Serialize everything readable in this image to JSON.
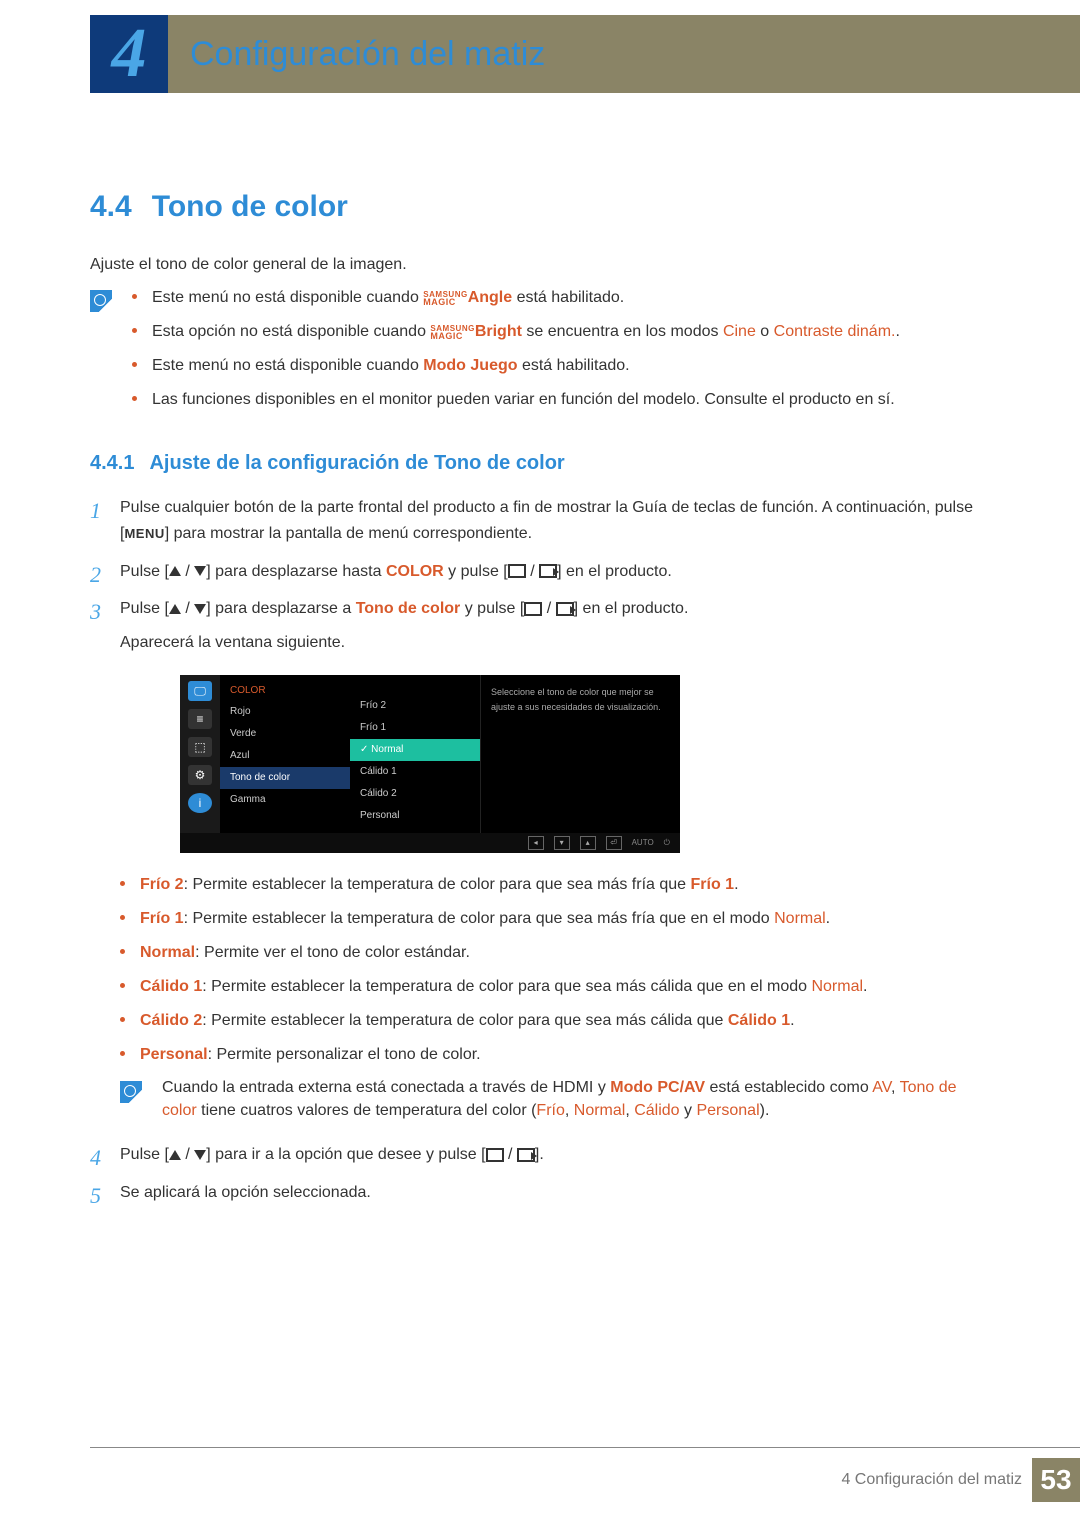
{
  "chapter": {
    "num": "4",
    "title": "Configuración del matiz"
  },
  "section": {
    "num": "4.4",
    "title": "Tono de color"
  },
  "intro": "Ajuste el tono de color general de la imagen.",
  "magic_brand": {
    "top": "SAMSUNG",
    "bottom": "MAGIC"
  },
  "notes1": {
    "b1_a": "Este menú no está disponible cuando ",
    "b1_b": "Angle",
    "b1_c": " está habilitado.",
    "b2_a": "Esta opción no está disponible cuando ",
    "b2_b": "Bright",
    "b2_c": " se encuentra en los modos ",
    "b2_cine": "Cine",
    "b2_d": " o ",
    "b2_contraste": "Contraste dinám.",
    "b3_a": "Este menú no está disponible cuando ",
    "b3_modo": "Modo Juego",
    "b3_b": " está habilitado.",
    "b4": "Las funciones disponibles en el monitor pueden variar en función del modelo. Consulte el producto en sí."
  },
  "subsection": {
    "num": "4.4.1",
    "title": "Ajuste de la configuración de Tono de color"
  },
  "steps": {
    "s1a": "Pulse cualquier botón de la parte frontal del producto a fin de mostrar la Guía de teclas de función. A continuación, pulse [",
    "s1_key": "MENU",
    "s1b": "] para mostrar la pantalla de menú correspondiente.",
    "s2a": "Pulse [",
    "s2b": "] para desplazarse hasta ",
    "s2_color": "COLOR",
    "s2c": " y pulse [",
    "s2d": "] en el producto.",
    "s3a": "Pulse [",
    "s3b": "] para desplazarse a ",
    "s3_tono": "Tono de color",
    "s3c": " y pulse [",
    "s3d": "] en el producto.",
    "s3e": "Aparecerá la ventana siguiente.",
    "s4a": "Pulse [",
    "s4b": "] para ir a la opción que desee y pulse [",
    "s4c": "].",
    "s5": "Se aplicará la opción seleccionada."
  },
  "osd": {
    "title": "COLOR",
    "items": {
      "rojo": "Rojo",
      "verde": "Verde",
      "azul": "Azul",
      "tono": "Tono de color",
      "gamma": "Gamma"
    },
    "options": {
      "frio2": "Frío 2",
      "frio1": "Frío 1",
      "normal": "Normal",
      "calido1": "Cálido 1",
      "calido2": "Cálido 2",
      "personal": "Personal"
    },
    "info": "Seleccione el tono de color que mejor se ajuste a sus necesidades de visualización.",
    "auto": "AUTO"
  },
  "desc": {
    "frio2_l": "Frío 2",
    "frio2": ": Permite establecer la temperatura de color para que sea más fría que ",
    "frio2_r": "Frío 1",
    "frio1_l": "Frío 1",
    "frio1": ": Permite establecer la temperatura de color para que sea más fría que en el modo ",
    "frio1_r": "Normal",
    "normal_l": "Normal",
    "normal": ": Permite ver el tono de color estándar.",
    "cal1_l": "Cálido 1",
    "cal1": ": Permite establecer la temperatura de color para que sea más cálida que en el modo ",
    "cal1_r": "Normal",
    "cal2_l": "Cálido 2",
    "cal2": ": Permite establecer la temperatura de color para que sea más cálida que ",
    "cal2_r": "Cálido 1",
    "pers_l": "Personal",
    "pers": ": Permite personalizar el tono de color."
  },
  "note2": {
    "a": "Cuando la entrada externa está conectada a través de HDMI y ",
    "modo": "Modo PC/AV",
    "b": " está establecido como ",
    "av": "AV",
    "c": ", ",
    "tono": "Tono de color",
    "d": " tiene cuatros valores de temperatura del color (",
    "frio": "Frío",
    "e": ", ",
    "normal": "Normal",
    "f": ", ",
    "calido": "Cálido",
    "g": " y ",
    "personal": "Personal",
    "h": ")."
  },
  "footer": {
    "text_prefix": "4 ",
    "text": "Configuración del matiz",
    "page": "53"
  }
}
